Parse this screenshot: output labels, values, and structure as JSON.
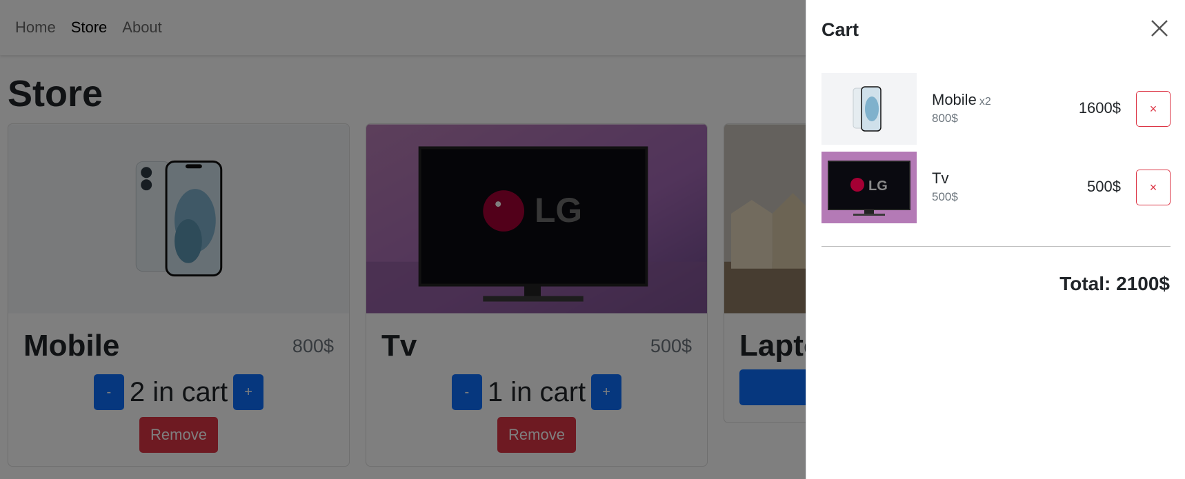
{
  "nav": {
    "items": [
      {
        "label": "Home"
      },
      {
        "label": "Store"
      },
      {
        "label": "About"
      }
    ]
  },
  "page": {
    "title": "Store"
  },
  "products": [
    {
      "name": "Mobile",
      "price": "800$",
      "minus": "-",
      "qty_text": "2 in cart",
      "plus": "+",
      "remove": "Remove"
    },
    {
      "name": "Tv",
      "price": "500$",
      "minus": "-",
      "qty_text": "1 in cart",
      "plus": "+",
      "remove": "Remove"
    },
    {
      "name": "Laptop"
    }
  ],
  "cart": {
    "title": "Cart",
    "items": [
      {
        "name": "Mobile",
        "multiplier": "x2",
        "unit_price": "800$",
        "line_total": "1600$",
        "remove": "×"
      },
      {
        "name": "Tv",
        "multiplier": "",
        "unit_price": "500$",
        "line_total": "500$",
        "remove": "×"
      }
    ],
    "total": "Total: 2100$"
  },
  "images": {
    "tv_logo": "LG"
  },
  "colors": {
    "primary": "#0d6efd",
    "danger": "#dc3545",
    "muted": "#6c757d"
  }
}
